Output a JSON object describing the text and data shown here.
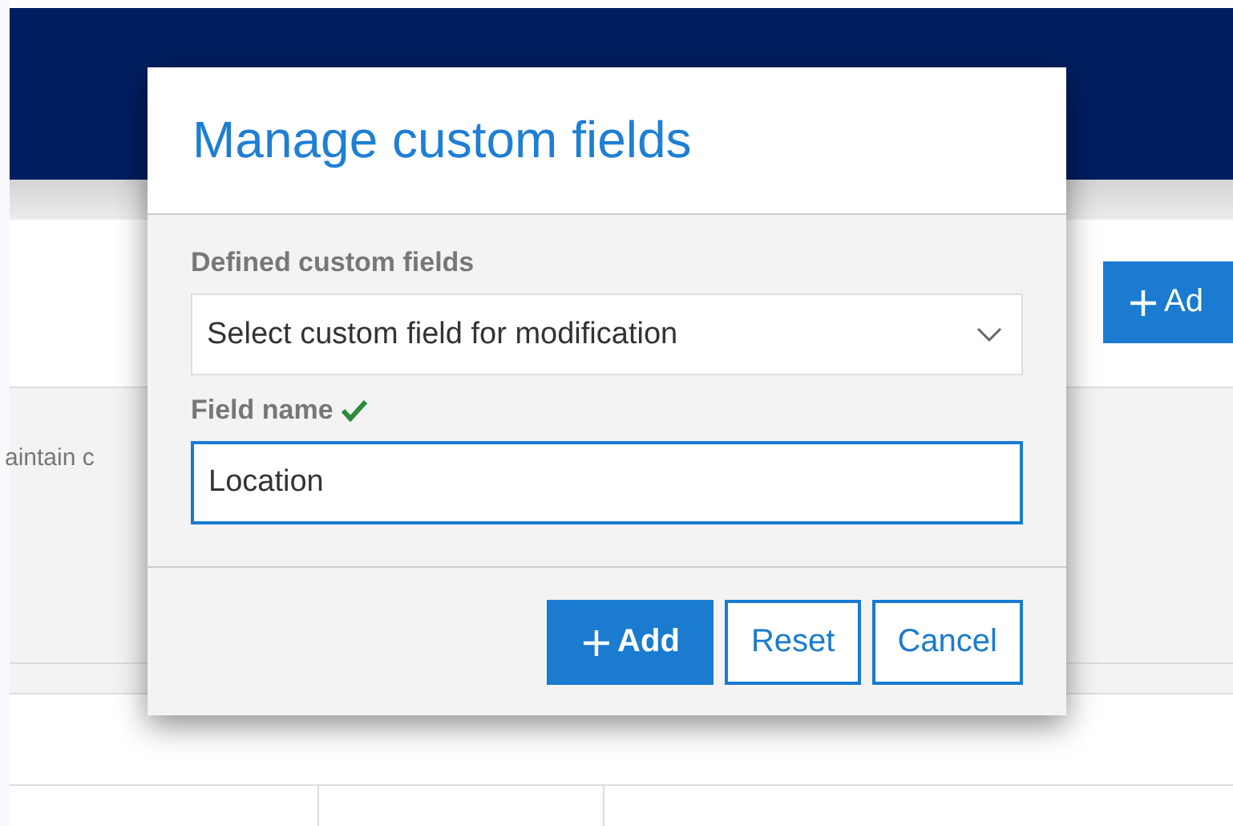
{
  "background": {
    "add_button": "Ad",
    "description": "aintain c"
  },
  "dialog": {
    "title": "Manage custom fields",
    "defined_fields": {
      "label": "Defined custom fields",
      "value": "Select custom field for modification"
    },
    "field_name": {
      "label": "Field name",
      "valid": true,
      "value": "Location"
    },
    "buttons": [
      {
        "label": "Add",
        "kind": "primary"
      },
      {
        "label": "Reset",
        "kind": "secondary"
      },
      {
        "label": "Cancel",
        "kind": "secondary"
      }
    ]
  }
}
